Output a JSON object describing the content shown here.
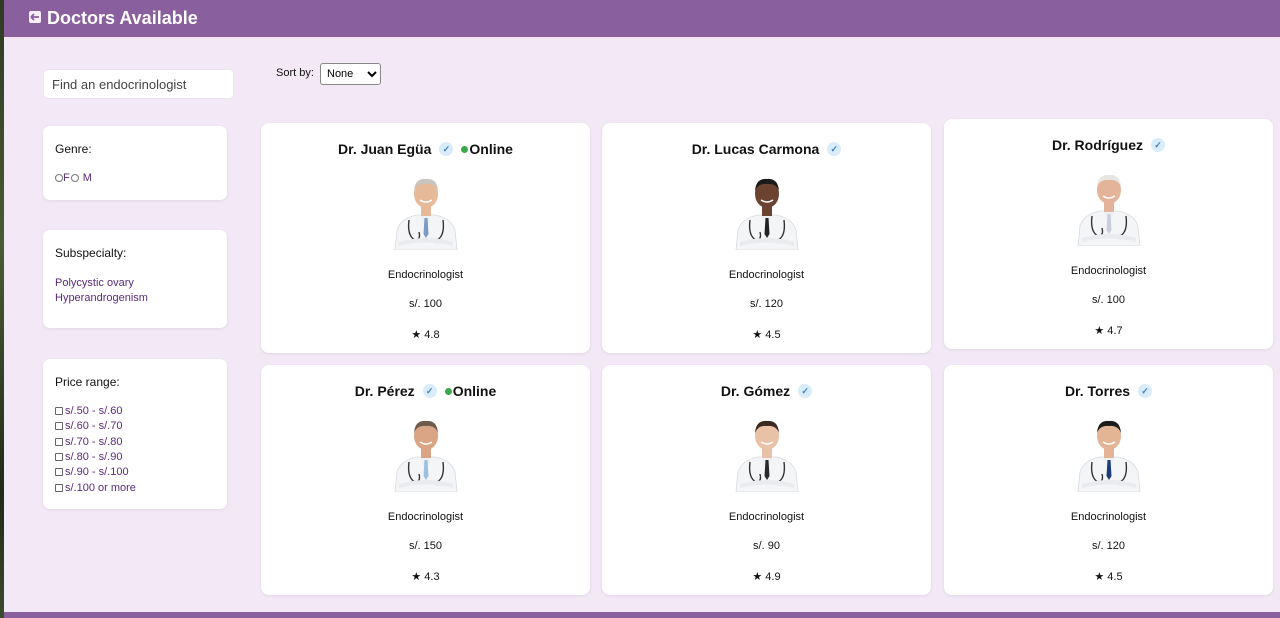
{
  "header": {
    "title": "Doctors Available"
  },
  "search": {
    "placeholder": "Find an endocrinologist"
  },
  "sort": {
    "label": "Sort by:",
    "selected": "None"
  },
  "filters": {
    "genre": {
      "title": "Genre:",
      "options": [
        "F",
        "M"
      ]
    },
    "subspecialty": {
      "title": "Subspecialty:",
      "items": [
        "Polycystic ovary",
        "Hyperandrogenism"
      ]
    },
    "price": {
      "title": "Price range:",
      "ranges": [
        "s/.50 - s/.60",
        "s/.60 - s/.70",
        "s/.70 - s/.80",
        "s/.80 - s/.90",
        "s/.90 - s/.100",
        "s/.100 or more"
      ]
    }
  },
  "doctors": [
    {
      "name": "Dr. Juan Egüa",
      "online": true,
      "online_label": "Online",
      "specialty": "Endocrinologist",
      "price": "s/. 100",
      "rating": "★ 4.8",
      "tie_color": "#7a9bc4",
      "skin": "#e6b999",
      "hair": "#c9c4bd"
    },
    {
      "name": "Dr. Lucas Carmona",
      "online": false,
      "online_label": "",
      "specialty": "Endocrinologist",
      "price": "s/. 120",
      "rating": "★ 4.5",
      "tie_color": "#222222",
      "skin": "#6b4330",
      "hair": "#1a1a1a"
    },
    {
      "name": "Dr. Rodríguez",
      "online": false,
      "online_label": "",
      "specialty": "Endocrinologist",
      "price": "s/. 100",
      "rating": "★ 4.7",
      "tie_color": "#c9cfd8",
      "skin": "#e3b49a",
      "hair": "#e8e6e2"
    },
    {
      "name": "Dr. Pérez",
      "online": true,
      "online_label": "Online",
      "specialty": "Endocrinologist",
      "price": "s/. 150",
      "rating": "★ 4.3",
      "tie_color": "#9cc0e0",
      "skin": "#d9a585",
      "hair": "#6d5a4a"
    },
    {
      "name": "Dr. Gómez",
      "online": false,
      "online_label": "",
      "specialty": "Endocrinologist",
      "price": "s/. 90",
      "rating": "★ 4.9",
      "tie_color": "#2a2a2a",
      "skin": "#e8c1a6",
      "hair": "#3a2a20"
    },
    {
      "name": "Dr. Torres",
      "online": false,
      "online_label": "",
      "specialty": "Endocrinologist",
      "price": "s/. 120",
      "rating": "★ 4.5",
      "tie_color": "#1f3d7a",
      "skin": "#e3b594",
      "hair": "#1c1c1c"
    }
  ]
}
